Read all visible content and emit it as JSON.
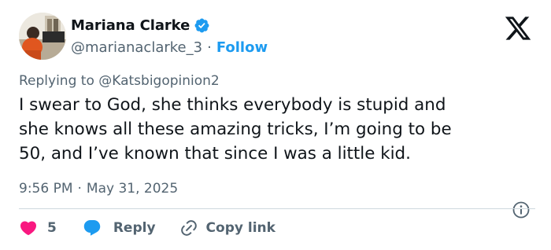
{
  "tweet": {
    "author": {
      "name": "Mariana Clarke",
      "handle": "@marianaclarke_3",
      "separator": "·",
      "follow_label": "Follow",
      "verified_icon": "verified-badge-icon",
      "verified_color": "#1d9bf0"
    },
    "platform_icon": "x-logo-icon",
    "replying_prefix": "Replying to ",
    "replying_to": "@Katsbigopinion2",
    "text": "I swear to God, she thinks everybody is stupid and\nshe knows all these amazing tricks, I’m going to be\n50, and I’ve known that since I was a little kid.",
    "time": "9:56 PM",
    "meta_separator": "·",
    "date": "May 31, 2025",
    "actions": {
      "like_count": "5",
      "like_color": "#f91880",
      "reply_label": "Reply",
      "reply_color": "#1d9bf0",
      "copy_link_label": "Copy link"
    }
  }
}
